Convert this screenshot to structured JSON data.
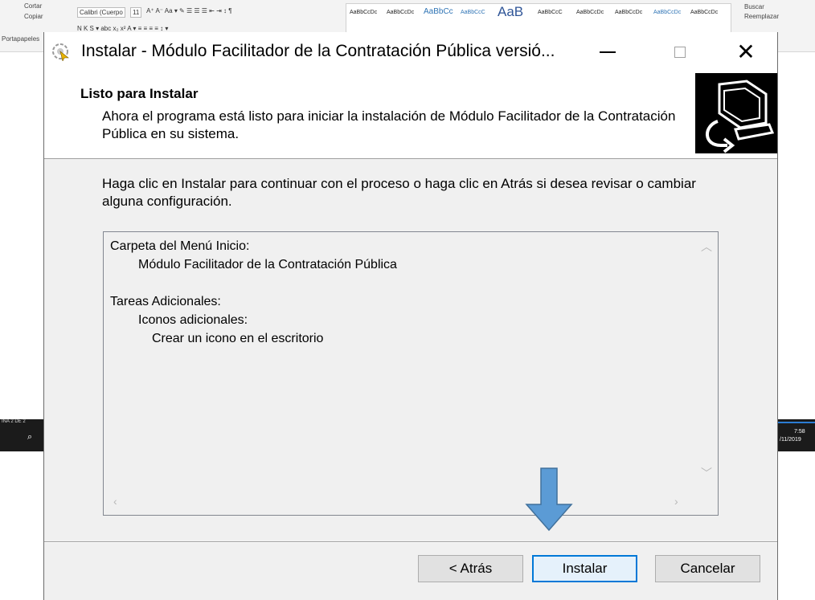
{
  "background": {
    "clipboard": {
      "cut": "Cortar",
      "copy": "Copiar",
      "paste": "Portapapeles"
    },
    "font_box": "Calibri (Cuerpo",
    "font_size": "11",
    "styles": [
      {
        "label": "AaBbCcDc",
        "cls": "bg-style",
        "x": 0
      },
      {
        "label": "AaBbCcDc",
        "cls": "bg-style",
        "x": 0
      },
      {
        "label": "AaBbCc",
        "cls": "bg-style mid",
        "x": 0
      },
      {
        "label": "AaBbCcC",
        "cls": "bg-style blue",
        "x": 0
      },
      {
        "label": "AaB",
        "cls": "bg-style big",
        "x": 0
      },
      {
        "label": "AaBbCcC",
        "cls": "bg-style",
        "x": 0
      },
      {
        "label": "AaBbCcDc",
        "cls": "bg-style",
        "x": 0
      },
      {
        "label": "AaBbCcDc",
        "cls": "bg-style",
        "x": 0
      },
      {
        "label": "AaBbCcDc",
        "cls": "bg-style blue",
        "x": 0
      },
      {
        "label": "AaBbCcDc",
        "cls": "bg-style",
        "x": 0
      }
    ],
    "edit": {
      "find": "Buscar",
      "replace": "Reemplazar"
    },
    "status_page": "INA 2 DE 2",
    "clock_time": "7:58",
    "clock_date": "/11/2019"
  },
  "dialog": {
    "title": "Instalar - Módulo Facilitador de la Contratación Pública versió...",
    "header_title": "Listo para Instalar",
    "header_subtitle": "Ahora el programa está listo para iniciar la instalación de Módulo Facilitador de la Contratación Pública en su sistema.",
    "body_text": "Haga clic en Instalar para continuar con el proceso o haga clic en Atrás si desea revisar o cambiar alguna configuración.",
    "memo": {
      "start_menu_label": "Carpeta del Menú Inicio:",
      "start_menu_value": "Módulo Facilitador de la Contratación Pública",
      "tasks_label": "Tareas Adicionales:",
      "tasks_group": "Iconos adicionales:",
      "tasks_item": "Crear un icono en el escritorio"
    },
    "buttons": {
      "back": "< Atrás",
      "install": "Instalar",
      "cancel": "Cancelar"
    }
  },
  "colors": {
    "accent": "#0078d7",
    "annotation_arrow": "#5b9bd5",
    "dialog_bg": "#f0f0f0"
  }
}
